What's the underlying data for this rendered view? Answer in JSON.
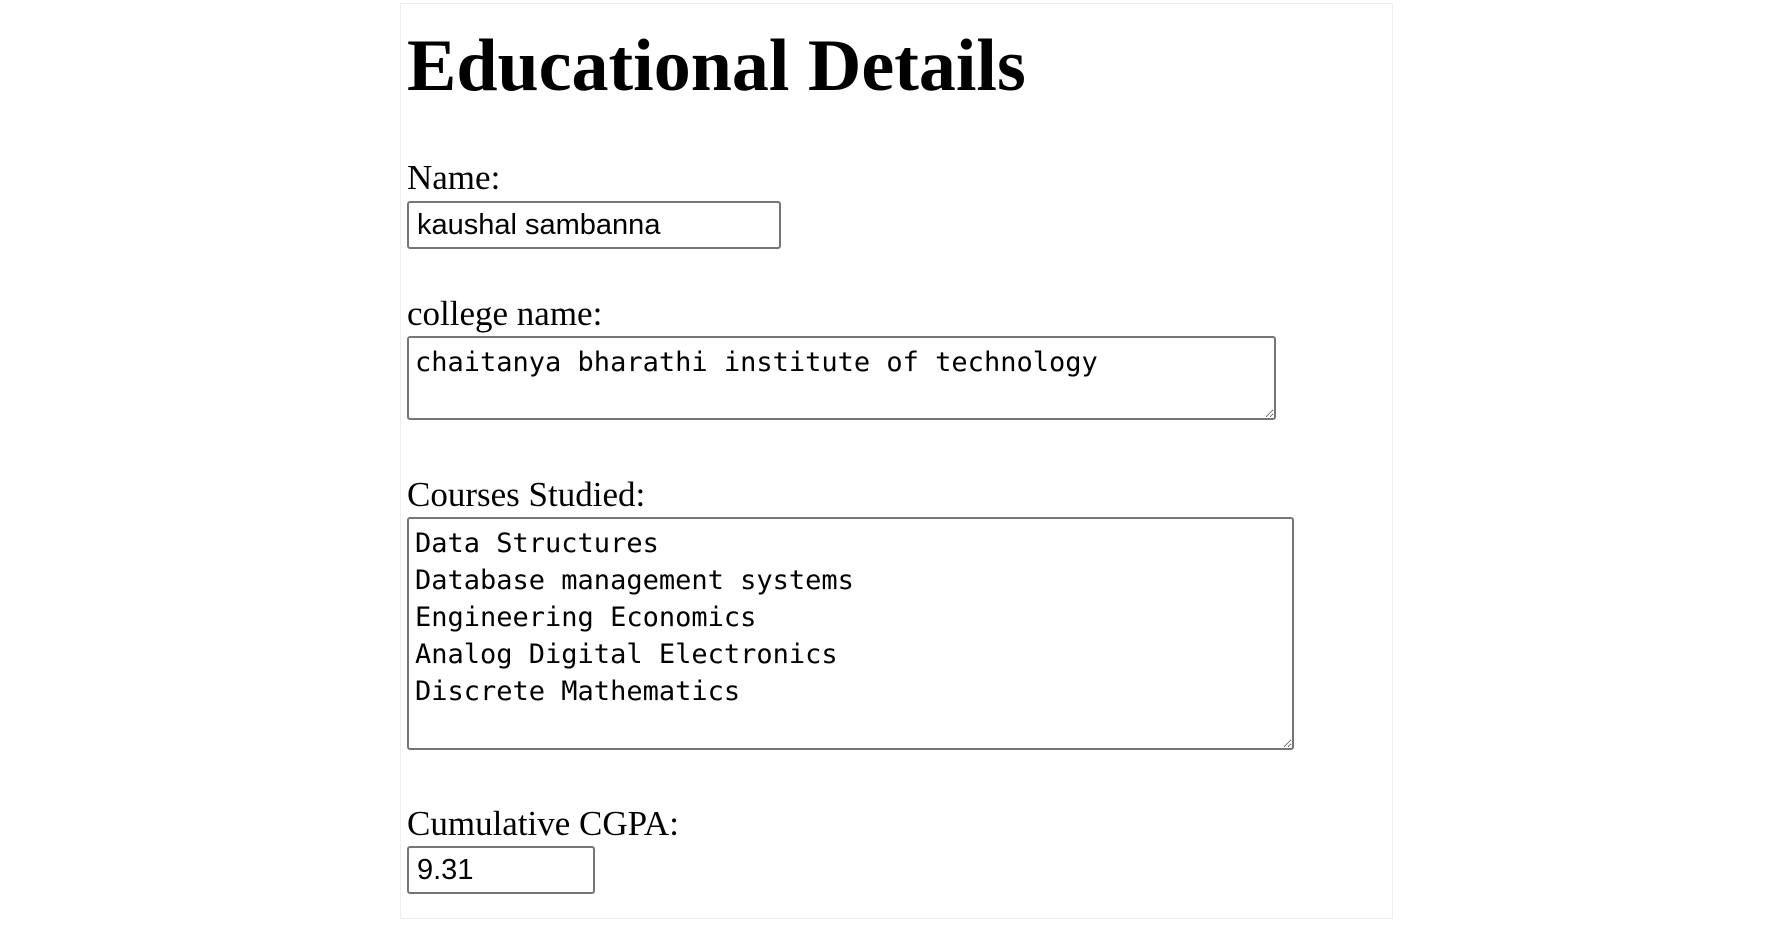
{
  "form": {
    "title": "Educational Details",
    "name": {
      "label": "Name:",
      "value": "kaushal sambanna"
    },
    "college": {
      "label": "college name:",
      "value": "chaitanya bharathi institute of technology"
    },
    "courses": {
      "label": "Courses Studied:",
      "value": "Data Structures\nDatabase management systems\nEngineering Economics\nAnalog Digital Electronics\nDiscrete Mathematics"
    },
    "cgpa": {
      "label": "Cumulative CGPA:",
      "value": "9.31"
    }
  }
}
